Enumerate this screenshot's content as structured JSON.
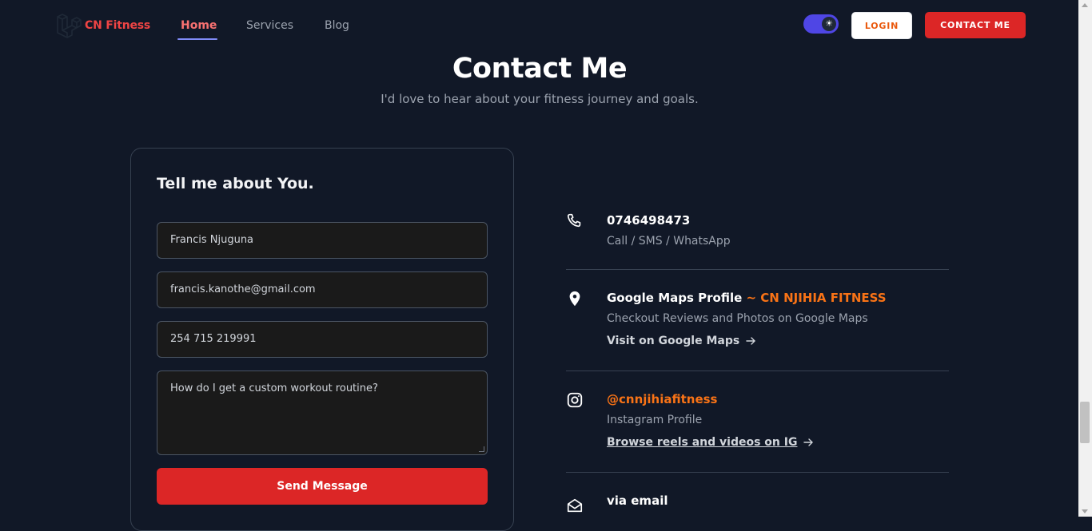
{
  "brand": {
    "name": "CN Fitness",
    "accent": "#ef4444"
  },
  "nav": {
    "items": [
      {
        "label": "Home",
        "active": true
      },
      {
        "label": "Services"
      },
      {
        "label": "Blog"
      }
    ]
  },
  "header": {
    "theme_toggle_icon": "sun-icon",
    "login_label": "LOGIN",
    "contact_label": "CONTACT ME"
  },
  "page": {
    "title": "Contact Me",
    "subtitle": "I'd love to hear about your fitness journey and goals."
  },
  "form": {
    "title": "Tell me about You.",
    "name_value": "Francis Njuguna",
    "email_value": "francis.kanothe@gmail.com",
    "phone_value": "254 715 219991",
    "message_value": "How do I get a custom workout routine?",
    "submit_label": "Send Message"
  },
  "contact": {
    "phone": {
      "number": "0746498473",
      "sub": "Call / SMS / WhatsApp",
      "icon": "phone-icon"
    },
    "maps": {
      "title": "Google Maps Profile",
      "accent": "~ CN NJIHIA FITNESS",
      "sub": "Checkout Reviews and Photos on Google Maps",
      "link": "Visit on Google Maps",
      "icon": "map-pin-icon"
    },
    "instagram": {
      "handle": "@cnnjihiafitness",
      "sub": "Instagram Profile",
      "link": "Browse reels and videos on IG",
      "icon": "instagram-icon"
    },
    "email": {
      "title": "via email",
      "icon": "mail-icon"
    }
  },
  "colors": {
    "background": "#111827",
    "primary": "#dc2626",
    "accent": "#f97316",
    "toggle": "#4f46e5"
  }
}
